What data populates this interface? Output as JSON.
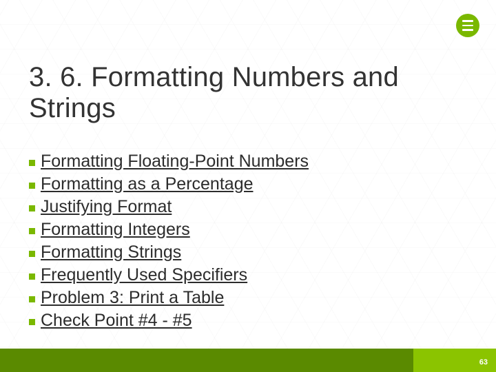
{
  "title": "3. 6. Formatting Numbers and Strings",
  "links": [
    "Formatting Floating-Point Numbers",
    "Formatting as a Percentage",
    "Justifying Format",
    "Formatting Integers",
    "Formatting Strings",
    "Frequently Used Specifiers",
    "Problem 3: Print a Table",
    "Check Point #4 - #5"
  ],
  "page_number": "63"
}
